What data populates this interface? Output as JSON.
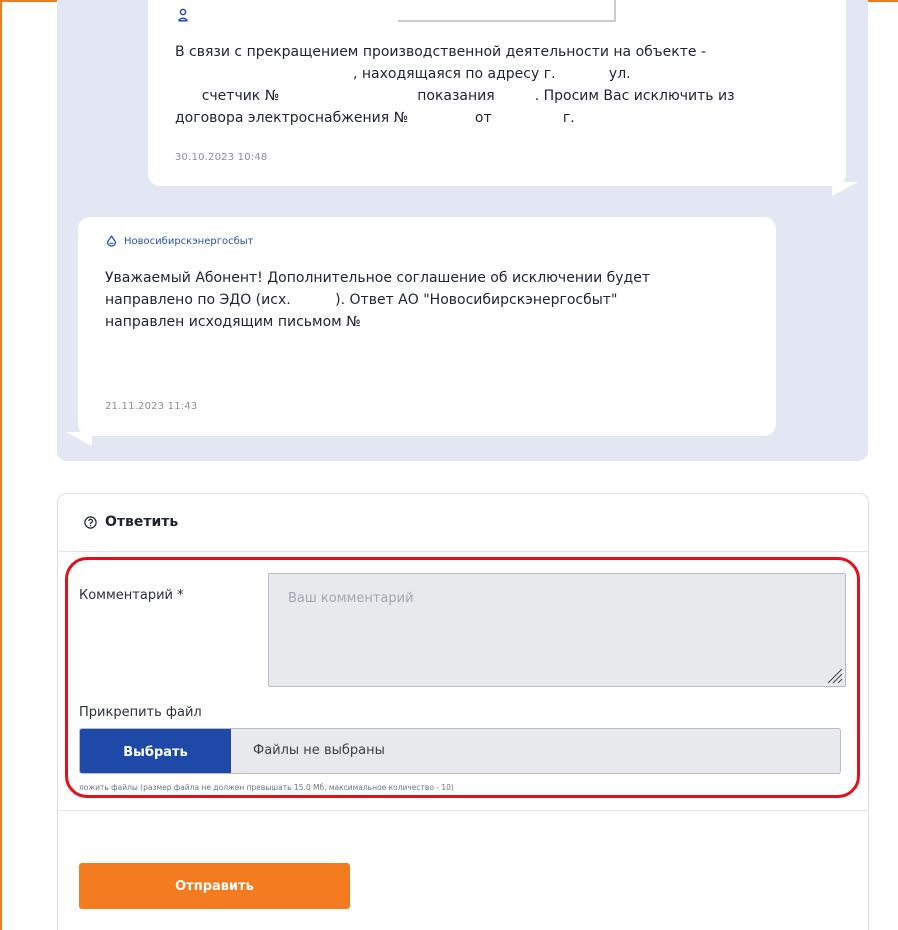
{
  "colors": {
    "accent": "#f47b20",
    "primary": "#1f49a8",
    "highlight": "#e3101c",
    "chat_bg": "#e3e7f3"
  },
  "messages": [
    {
      "icon": "user-icon",
      "lines": [
        "В связи с прекращением производственной деятельности на объекте -",
        "                                        , находящаяся по адресу г.            ул.",
        "      счетчик №                               показания         . Просим Вас исключить из",
        "договора электроснабжения №               от                г."
      ],
      "datetime": "30.10.2023   10:48"
    },
    {
      "icon": "drop-icon",
      "sender": "Новосибирскэнергосбыт",
      "lines": [
        "Уважаемый Абонент! Дополнительное соглашение об исключении будет",
        "направлено по ЭДО (исх.          ). Ответ АО \"Новосибирскэнергосбыт\"",
        "направлен исходящим письмом №"
      ],
      "datetime": "21.11.2023   11:43"
    }
  ],
  "reply": {
    "title": "Ответить",
    "comment_label": "Комментарий *",
    "comment_placeholder": "Ваш комментарий",
    "attach_label": "Прикрепить файл",
    "choose_button": "Выбрать",
    "file_status": "Файлы не выбраны",
    "hint": "ложить файлы (размер файла не должен превышать 15.0 Мб, максимальное количество - 10)",
    "submit_button": "Отправить"
  }
}
